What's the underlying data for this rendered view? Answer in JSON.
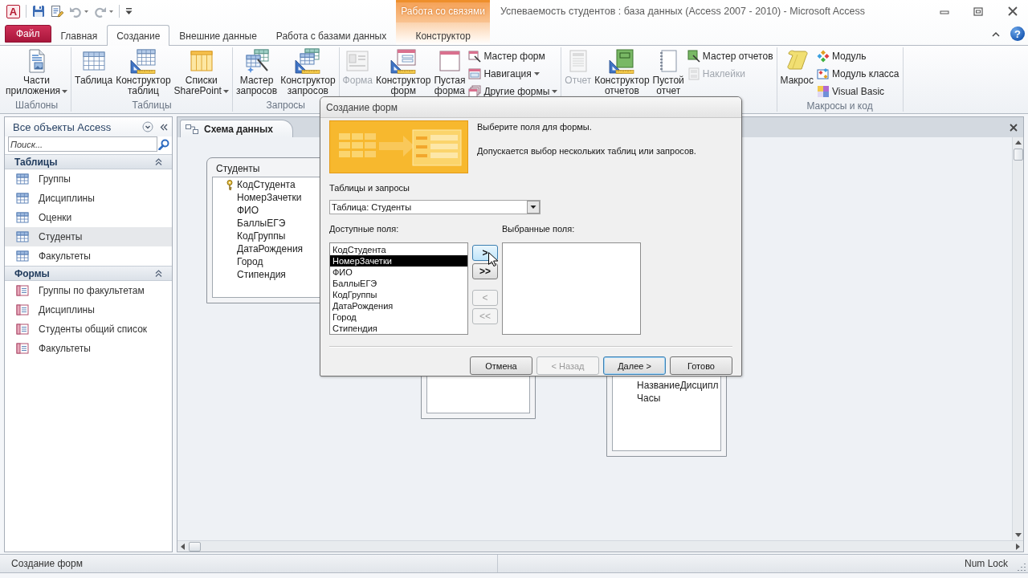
{
  "title_bar": {
    "logo": "A",
    "quick_access": [
      {
        "disabled": false,
        "dropdown": false
      },
      {
        "disabled": false,
        "dropdown": false
      },
      {
        "disabled": true,
        "dropdown": true
      },
      {
        "disabled": true,
        "dropdown": true
      }
    ],
    "title": "Успеваемость студентов : база данных (Access 2007 - 2010) - Microsoft Access"
  },
  "ribbon_tabs": [
    {
      "label": "Файл",
      "kind": "file",
      "selected": false
    },
    {
      "label": "Главная",
      "kind": "tab",
      "selected": false
    },
    {
      "label": "Создание",
      "kind": "tab",
      "selected": true
    },
    {
      "label": "Внешние данные",
      "kind": "tab",
      "selected": false
    },
    {
      "label": "Работа с базами данных",
      "kind": "tab",
      "selected": false
    },
    {
      "label": "Конструктор",
      "kind": "contextual",
      "group": "Работа со связями",
      "selected": false
    }
  ],
  "help_button": "?",
  "ribbon_groups": [
    {
      "label": "Шаблоны",
      "commands": [
        {
          "label": "Части\nприложения",
          "kind": "large",
          "dropdown": true,
          "disabled": false
        }
      ]
    },
    {
      "label": "Таблицы",
      "commands": [
        {
          "label": "Таблица",
          "kind": "large",
          "dropdown": false,
          "disabled": false
        },
        {
          "label": "Конструктор\nтаблиц",
          "kind": "large",
          "dropdown": false,
          "disabled": false
        },
        {
          "label": "Списки\nSharePoint",
          "kind": "large",
          "dropdown": true,
          "disabled": false
        }
      ]
    },
    {
      "label": "Запросы",
      "commands": [
        {
          "label": "Мастер\nзапросов",
          "kind": "large",
          "dropdown": false,
          "disabled": false
        },
        {
          "label": "Конструктор\nзапросов",
          "kind": "large",
          "dropdown": false,
          "disabled": false
        }
      ]
    },
    {
      "commands": [
        {
          "label": "Форма",
          "kind": "large",
          "dropdown": false,
          "disabled": true
        },
        {
          "label": "Конструктор\nформ",
          "kind": "large",
          "dropdown": false,
          "disabled": false
        },
        {
          "label": "Пустая\nформа",
          "kind": "large",
          "dropdown": false,
          "disabled": false
        },
        {
          "label": "Мастер форм",
          "kind": "small",
          "dropdown": false,
          "disabled": false
        },
        {
          "label": "Навигация",
          "kind": "small",
          "dropdown": true,
          "disabled": false
        },
        {
          "label": "Другие формы",
          "kind": "small",
          "dropdown": true,
          "disabled": false
        }
      ]
    },
    {
      "commands": [
        {
          "label": "Отчет",
          "kind": "large",
          "dropdown": false,
          "disabled": true
        },
        {
          "label": "Конструктор\nотчетов",
          "kind": "large",
          "dropdown": false,
          "disabled": false
        },
        {
          "label": "Пустой\nотчет",
          "kind": "large",
          "dropdown": false,
          "disabled": false
        },
        {
          "label": "Мастер отчетов",
          "kind": "small",
          "dropdown": false,
          "disabled": false
        },
        {
          "label": "Наклейки",
          "kind": "small",
          "dropdown": false,
          "disabled": true
        }
      ]
    },
    {
      "label": "Макросы и код",
      "commands": [
        {
          "label": "Макрос",
          "kind": "large",
          "dropdown": false,
          "disabled": false
        },
        {
          "label": "Модуль",
          "kind": "small",
          "dropdown": false,
          "disabled": false
        },
        {
          "label": "Модуль класса",
          "kind": "small",
          "dropdown": false,
          "disabled": false
        },
        {
          "label": "Visual Basic",
          "kind": "small",
          "dropdown": false,
          "disabled": false
        }
      ]
    }
  ],
  "navigation_pane": {
    "title": "Все объекты Access",
    "search": {
      "placeholder": "Поиск..."
    },
    "sections": [
      {
        "title": "Таблицы",
        "kind": "table",
        "expanded": true,
        "items": [
          {
            "label": "Группы",
            "selected": false
          },
          {
            "label": "Дисциплины",
            "selected": false
          },
          {
            "label": "Оценки",
            "selected": false
          },
          {
            "label": "Студенты",
            "selected": true
          },
          {
            "label": "Факультеты",
            "selected": false
          }
        ]
      },
      {
        "title": "Формы",
        "kind": "form",
        "expanded": true,
        "items": [
          {
            "label": "Группы по факультетам",
            "selected": false
          },
          {
            "label": "Дисциплины",
            "selected": false
          },
          {
            "label": "Студенты общий список",
            "selected": false
          },
          {
            "label": "Факультеты",
            "selected": false
          }
        ]
      }
    ]
  },
  "document": {
    "tab": "Схема данных",
    "schema_tables": [
      {
        "title": "Студенты",
        "fields": [
          {
            "name": "КодСтудента",
            "key": true
          },
          {
            "name": "НомерЗачетки",
            "key": false
          },
          {
            "name": "ФИО",
            "key": false
          },
          {
            "name": "БаллыЕГЭ",
            "key": false
          },
          {
            "name": "КодГруппы",
            "key": false
          },
          {
            "name": "ДатаРождения",
            "key": false
          },
          {
            "name": "Город",
            "key": false
          },
          {
            "name": "Стипендия",
            "key": false
          }
        ]
      },
      {
        "fields": [
          {
            "name": "НазваниеДисципл",
            "key": false
          },
          {
            "name": "Часы",
            "key": false
          }
        ]
      }
    ]
  },
  "dialog": {
    "title": "Создание форм",
    "heading": "Выберите поля для формы.",
    "hint": "Допускается выбор нескольких таблиц или запросов.",
    "source_label": "Таблицы и запросы",
    "source_value": "Таблица: Студенты",
    "available_label": "Доступные поля:",
    "selected_label": "Выбранные поля:",
    "available_fields": [
      {
        "name": "КодСтудента",
        "selected": false
      },
      {
        "name": "НомерЗачетки",
        "selected": true
      },
      {
        "name": "ФИО",
        "selected": false
      },
      {
        "name": "БаллыЕГЭ",
        "selected": false
      },
      {
        "name": "КодГруппы",
        "selected": false
      },
      {
        "name": "ДатаРождения",
        "selected": false
      },
      {
        "name": "Город",
        "selected": false
      },
      {
        "name": "Стипендия",
        "selected": false
      }
    ],
    "move_buttons": [
      {
        "label": ">",
        "disabled": false,
        "hovered": true
      },
      {
        "label": ">>",
        "disabled": false,
        "hovered": false
      },
      {
        "label": "<",
        "disabled": true,
        "hovered": false
      },
      {
        "label": "<<",
        "disabled": true,
        "hovered": false
      }
    ],
    "buttons": [
      {
        "label": "Отмена",
        "disabled": false,
        "default": false
      },
      {
        "label": "< Назад",
        "disabled": true,
        "default": false
      },
      {
        "label": "Далее >",
        "disabled": false,
        "default": true
      },
      {
        "label": "Готово",
        "disabled": false,
        "default": false
      }
    ]
  },
  "status_bar": {
    "message": "Создание форм",
    "indicator": "Num Lock"
  }
}
